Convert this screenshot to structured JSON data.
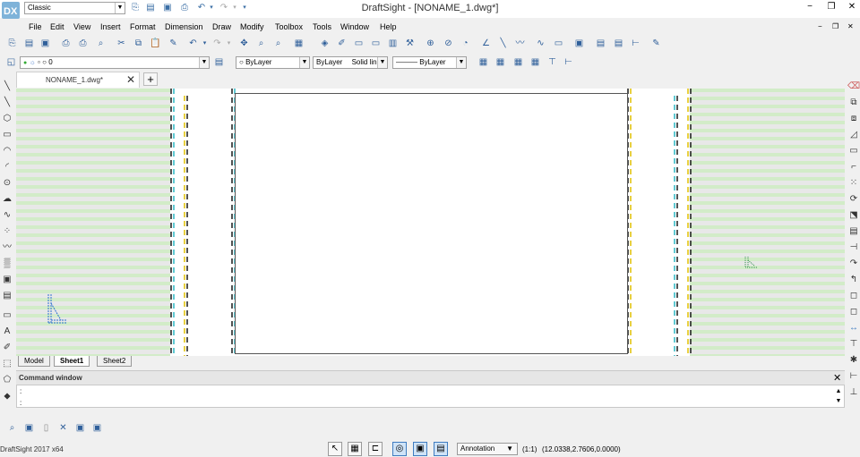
{
  "titlebar": {
    "workspace": "Classic",
    "title": "DraftSight - [NONAME_1.dwg*]"
  },
  "menu": [
    "File",
    "Edit",
    "View",
    "Insert",
    "Format",
    "Dimension",
    "Draw",
    "Modify",
    "Toolbox",
    "Tools",
    "Window",
    "Help"
  ],
  "layer_bar": {
    "layer": "0",
    "color": "ByLayer",
    "linestyle_layer": "ByLayer",
    "linestyle": "Solid line",
    "lineweight": "ByLayer"
  },
  "document_tab": {
    "label": "NONAME_1.dwg*"
  },
  "sheet_tabs": [
    {
      "label": "Model"
    },
    {
      "label": "Sheet1"
    },
    {
      "label": "Sheet2"
    }
  ],
  "command_window": {
    "title": "Command window",
    "lines": [
      ":",
      ":"
    ]
  },
  "status": {
    "app": "DraftSight 2017 x64",
    "annotation": "Annotation",
    "scale": "(1:1)",
    "coords": "(12.0338,2.7606,0.0000)"
  },
  "colors": {
    "stripe_green": "#d2ecc8",
    "stripe_gray": "#e8e8e8",
    "accent": "#3f7cc0"
  }
}
